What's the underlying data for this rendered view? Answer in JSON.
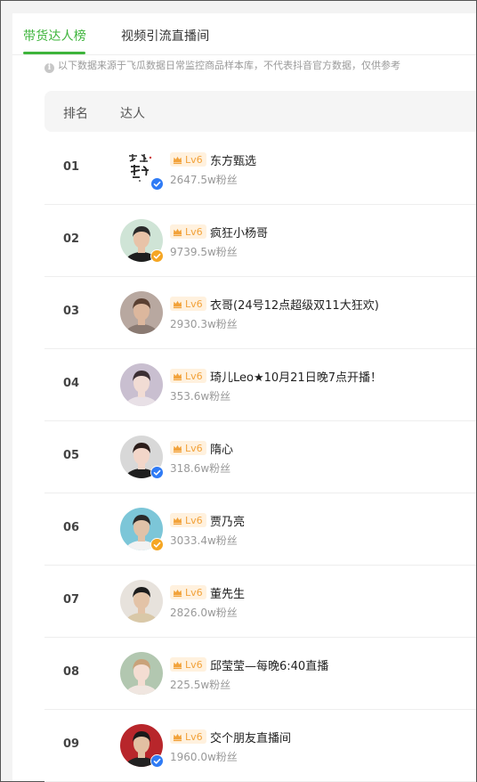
{
  "tabs": [
    {
      "label": "带货达人榜",
      "active": true
    },
    {
      "label": "视频引流直播间",
      "active": false
    }
  ],
  "notice": "以下数据来源于飞瓜数据日常监控商品样本库，不代表抖音官方数据，仅供参考",
  "table_headers": {
    "rank": "排名",
    "talent": "达人"
  },
  "colors": {
    "accent": "#3db43b",
    "level_text": "#f2a23a",
    "level_bg": "#fff1de",
    "verified_blue": "#2f7bf5",
    "verified_gold": "#f5a623"
  },
  "rows": [
    {
      "rank": "01",
      "level": "Lv6",
      "name": "东方甄选",
      "fans": "2647.5w粉丝",
      "badge": "blue"
    },
    {
      "rank": "02",
      "level": "Lv6",
      "name": "疯狂小杨哥",
      "fans": "9739.5w粉丝",
      "badge": "gold"
    },
    {
      "rank": "03",
      "level": "Lv6",
      "name": "衣哥(24号12点超级双11大狂欢)",
      "fans": "2930.3w粉丝",
      "badge": "none"
    },
    {
      "rank": "04",
      "level": "Lv6",
      "name": "琦儿Leo★10月21日晚7点开播！",
      "fans": "353.6w粉丝",
      "badge": "none"
    },
    {
      "rank": "05",
      "level": "Lv6",
      "name": "隋心",
      "fans": "318.6w粉丝",
      "badge": "blue"
    },
    {
      "rank": "06",
      "level": "Lv6",
      "name": "贾乃亮",
      "fans": "3033.4w粉丝",
      "badge": "gold"
    },
    {
      "rank": "07",
      "level": "Lv6",
      "name": "董先生",
      "fans": "2826.0w粉丝",
      "badge": "none"
    },
    {
      "rank": "08",
      "level": "Lv6",
      "name": "邱莹莹—每晚6:40直播",
      "fans": "225.5w粉丝",
      "badge": "none"
    },
    {
      "rank": "09",
      "level": "Lv6",
      "name": "交个朋友直播间",
      "fans": "1960.0w粉丝",
      "badge": "blue"
    }
  ]
}
